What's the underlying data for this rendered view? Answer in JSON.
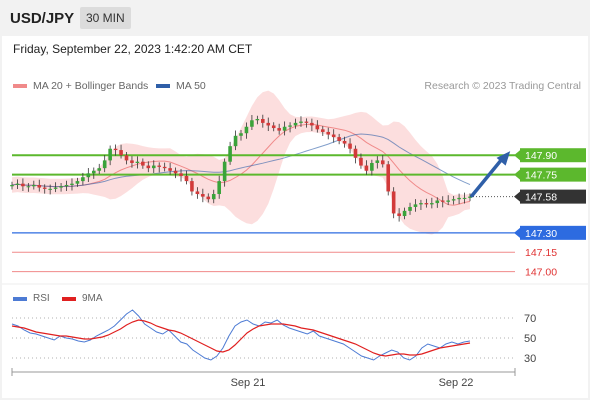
{
  "header": {
    "pair": "USD/JPY",
    "timeframe": "30 MIN"
  },
  "datetime": "Friday, September 22, 2023 1:42:20 AM CET",
  "legend": [
    {
      "label": "MA 20 + Bollinger Bands",
      "color": "#f08a8a"
    },
    {
      "label": "MA 50",
      "color": "#2f5fa8"
    }
  ],
  "credit": "Research © 2023 Trading Central",
  "chart_data": [
    {
      "type": "candlestick",
      "title": "USD/JPY 30 MIN",
      "ylim": [
        146.92,
        148.35
      ],
      "x_ticks": [
        "Sep 21",
        "Sep 22"
      ],
      "close_series": [
        147.67,
        147.68,
        147.66,
        147.66,
        147.67,
        147.65,
        147.64,
        147.64,
        147.65,
        147.66,
        147.67,
        147.68,
        147.7,
        147.73,
        147.76,
        147.78,
        147.8,
        147.86,
        147.95,
        147.94,
        147.9,
        147.86,
        147.84,
        147.85,
        147.82,
        147.8,
        147.82,
        147.81,
        147.8,
        147.78,
        147.76,
        147.74,
        147.7,
        147.62,
        147.6,
        147.58,
        147.56,
        147.6,
        147.7,
        147.85,
        147.97,
        148.05,
        148.07,
        148.12,
        148.17,
        148.18,
        148.15,
        148.13,
        148.11,
        148.09,
        148.12,
        148.13,
        148.15,
        148.16,
        148.15,
        148.13,
        148.1,
        148.08,
        148.06,
        148.04,
        148.01,
        147.99,
        147.95,
        147.88,
        147.82,
        147.78,
        147.84,
        147.86,
        147.83,
        147.62,
        147.45,
        147.43,
        147.47,
        147.5,
        147.52,
        147.53,
        147.52,
        147.53,
        147.55,
        147.54,
        147.55,
        147.56,
        147.57,
        147.57,
        147.58
      ],
      "candles_note": "red = bearish, green = bullish",
      "levels": [
        {
          "value": 147.9,
          "label": "147.90",
          "kind": "resistance-2",
          "color": "#5cb82d"
        },
        {
          "value": 147.75,
          "label": "147.75",
          "kind": "resistance-1",
          "color": "#5cb82d"
        },
        {
          "value": 147.58,
          "label": "147.58",
          "kind": "last-price",
          "color": "#333333"
        },
        {
          "value": 147.3,
          "label": "147.30",
          "kind": "pivot",
          "color": "#2d6be0"
        },
        {
          "value": 147.15,
          "label": "147.15",
          "kind": "support-1",
          "color": "#e03333"
        },
        {
          "value": 147.0,
          "label": "147.00",
          "kind": "support-2",
          "color": "#e03333"
        }
      ],
      "indicators": [
        "MA 20 + Bollinger Bands",
        "MA 50"
      ],
      "forecast": "upward arrow toward 147.90"
    },
    {
      "type": "line",
      "title": "RSI",
      "ylim": [
        20,
        80
      ],
      "y_ticks": [
        70,
        50,
        30
      ],
      "x_ticks": [
        "Sep 21",
        "Sep 22"
      ],
      "series": [
        {
          "name": "RSI",
          "color": "#4d7bd4",
          "values": [
            64,
            62,
            58,
            55,
            54,
            52,
            50,
            48,
            52,
            50,
            49,
            47,
            46,
            48,
            52,
            55,
            58,
            62,
            68,
            74,
            78,
            72,
            64,
            60,
            56,
            54,
            58,
            52,
            46,
            44,
            38,
            34,
            30,
            28,
            32,
            40,
            52,
            62,
            66,
            68,
            64,
            62,
            66,
            65,
            68,
            63,
            60,
            58,
            56,
            54,
            57,
            52,
            50,
            48,
            46,
            44,
            40,
            36,
            32,
            30,
            28,
            32,
            35,
            38,
            36,
            30,
            28,
            32,
            40,
            44,
            42,
            40,
            44,
            46,
            44,
            46,
            47
          ]
        },
        {
          "name": "9MA",
          "color": "#e02020",
          "values": [
            62,
            61,
            60,
            58,
            56,
            55,
            54,
            53,
            52,
            52,
            51,
            50,
            49,
            49,
            50,
            51,
            53,
            56,
            59,
            63,
            66,
            68,
            67,
            65,
            62,
            60,
            58,
            57,
            55,
            52,
            49,
            46,
            43,
            40,
            37,
            36,
            38,
            43,
            49,
            55,
            59,
            62,
            63,
            64,
            64,
            64,
            63,
            62,
            60,
            59,
            58,
            56,
            54,
            52,
            50,
            48,
            46,
            44,
            41,
            38,
            35,
            33,
            32,
            33,
            34,
            34,
            33,
            33,
            34,
            36,
            38,
            40,
            41,
            42,
            43,
            44,
            45
          ]
        }
      ]
    }
  ],
  "rsi_legend": [
    {
      "label": "RSI",
      "color": "#4d7bd4"
    },
    {
      "label": "9MA",
      "color": "#e02020"
    }
  ]
}
